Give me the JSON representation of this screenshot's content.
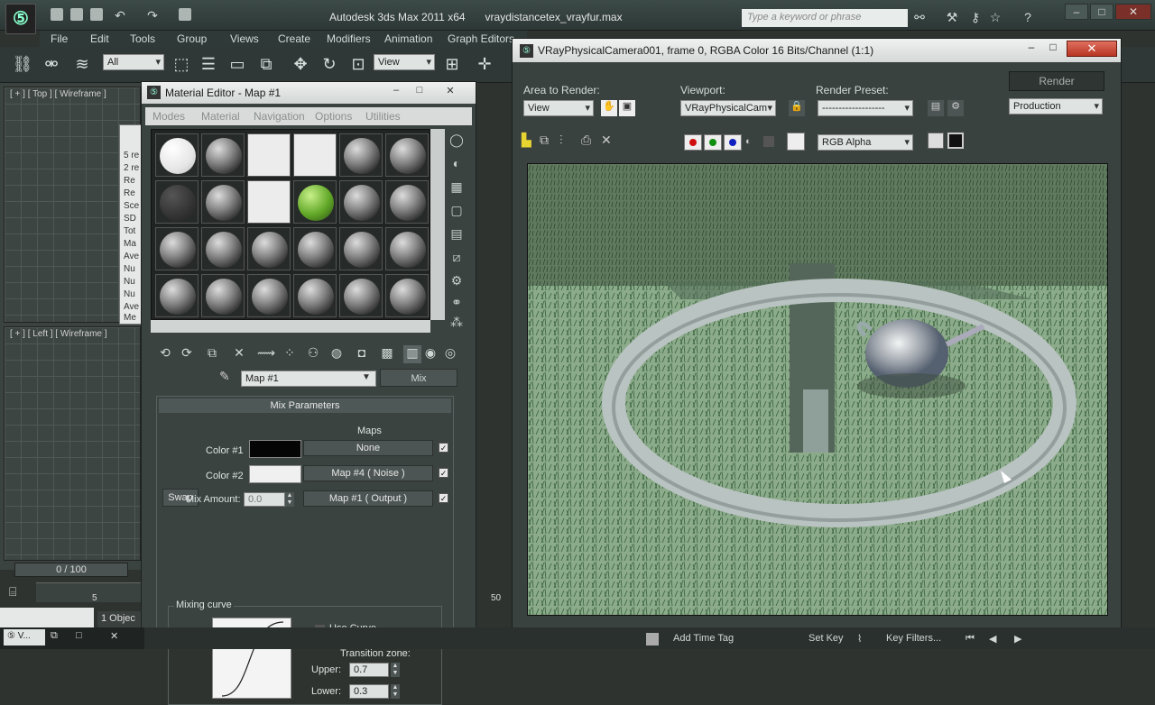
{
  "app": {
    "title_product": "Autodesk 3ds Max  2011 x64",
    "title_file": "vraydistancetex_vrayfur.max",
    "search_placeholder": "Type a keyword or phrase"
  },
  "menus": [
    "File",
    "Edit",
    "Tools",
    "Group",
    "Views",
    "Create",
    "Modifiers",
    "Animation",
    "Graph Editors"
  ],
  "toolbar": {
    "selection_filter": "All",
    "ref_coord": "View"
  },
  "viewports": {
    "top_label": "[ + ] [ Top ] [ Wireframe ]",
    "left_label": "[ + ] [ Left ] [ Wireframe ]"
  },
  "timeline": {
    "frame_display": "0 / 100",
    "tick_5": "5",
    "tick_50": "50",
    "objects_selected": "1 Objec"
  },
  "side_list": [
    "5 re",
    "2 re",
    "Re",
    "Re",
    "Sce",
    "SD",
    "Tot",
    "Ma",
    "Ave",
    "Nu",
    "Nu",
    "Nu",
    "Ave",
    "Me"
  ],
  "material_editor": {
    "title": "Material Editor - Map #1",
    "menu": [
      "Modes",
      "Material",
      "Navigation",
      "Options",
      "Utilities"
    ],
    "map_name": "Map #1",
    "map_type": "Mix",
    "panel_title": "Mix Parameters",
    "maps_header": "Maps",
    "swap_label": "Swap",
    "color1_label": "Color #1",
    "color1_map": "None",
    "color2_label": "Color #2",
    "color2_map": "Map #4  ( Noise )",
    "mix_amount_label": "Mix Amount:",
    "mix_amount_value": "0.0",
    "mix_map": "Map #1  ( Output )",
    "mixing_curve_label": "Mixing curve",
    "use_curve_label": "Use Curve",
    "transition_zone_label": "Transition zone:",
    "upper_label": "Upper:",
    "upper_value": "0.7",
    "lower_label": "Lower:",
    "lower_value": "0.3",
    "colors": {
      "color1": "#050505",
      "color2": "#f0f0f0"
    }
  },
  "render_window": {
    "title": "VRayPhysicalCamera001, frame 0, RGBA Color 16 Bits/Channel (1:1)",
    "area_label": "Area to Render:",
    "area_value": "View",
    "viewport_label": "Viewport:",
    "viewport_value": "VRayPhysicalCam",
    "preset_label": "Render Preset:",
    "preset_value": "-------------------",
    "render_button": "Render",
    "production_value": "Production",
    "channel_value": "RGB Alpha",
    "close_symbol": "✕"
  },
  "statusbar": {
    "add_time_tag": "Add Time Tag",
    "set_key": "Set Key",
    "key_filters": "Key Filters..."
  }
}
